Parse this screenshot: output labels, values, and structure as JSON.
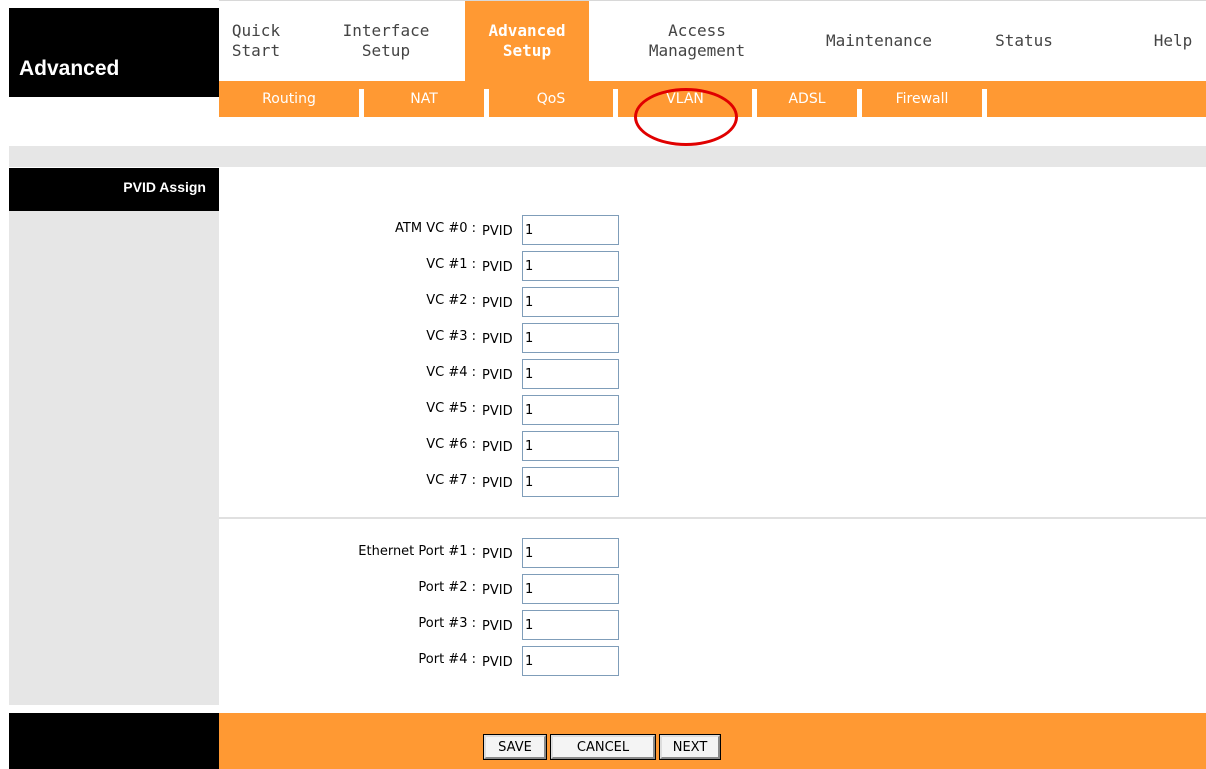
{
  "brand": "Advanced",
  "menu": [
    {
      "label": "Quick\nStart",
      "active": false
    },
    {
      "label": "Interface\nSetup",
      "active": false
    },
    {
      "label": "Advanced\nSetup",
      "active": true
    },
    {
      "label": "Access\nManagement",
      "active": false
    },
    {
      "label": "Maintenance",
      "active": false
    },
    {
      "label": "Status",
      "active": false
    },
    {
      "label": "Help",
      "active": false
    }
  ],
  "submenu": [
    "Routing",
    "NAT",
    "QoS",
    "VLAN",
    "ADSL",
    "Firewall"
  ],
  "section_title": "PVID Assign",
  "pvid_label": "PVID",
  "vc_rows": [
    {
      "label": "ATM VC #0 :",
      "value": "1"
    },
    {
      "label": "VC #1 :",
      "value": "1"
    },
    {
      "label": "VC #2 :",
      "value": "1"
    },
    {
      "label": "VC #3 :",
      "value": "1"
    },
    {
      "label": "VC #4 :",
      "value": "1"
    },
    {
      "label": "VC #5 :",
      "value": "1"
    },
    {
      "label": "VC #6 :",
      "value": "1"
    },
    {
      "label": "VC #7 :",
      "value": "1"
    }
  ],
  "port_rows": [
    {
      "label": "Ethernet Port #1 :",
      "value": "1"
    },
    {
      "label": "Port #2 :",
      "value": "1"
    },
    {
      "label": "Port #3 :",
      "value": "1"
    },
    {
      "label": "Port #4 :",
      "value": "1"
    }
  ],
  "buttons": {
    "save": "SAVE",
    "cancel": "CANCEL",
    "next": "NEXT"
  },
  "colors": {
    "accent": "#ff9933",
    "highlight_circle": "#e00000",
    "panel_gray": "#e6e6e6"
  }
}
